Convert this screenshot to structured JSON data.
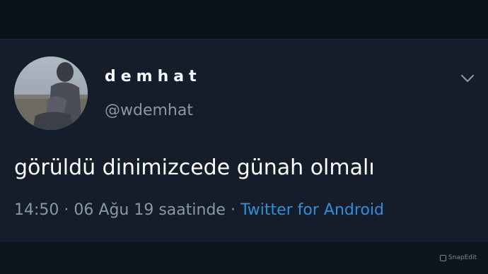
{
  "user": {
    "display_name": "demhat",
    "handle": "@wdemhat"
  },
  "tweet": {
    "text": "görüldü dinimizcede günah olmalı",
    "time": "14:50",
    "separator": "·",
    "date": "06 Ağu 19 saatinde",
    "source": "Twitter for Android"
  },
  "icons": {
    "menu": "chevron-down-icon",
    "watermark": "snapedit-logo-icon"
  },
  "watermark": {
    "text": "SnapEdit"
  },
  "colors": {
    "background": "#141d29",
    "name": "#f5f7fa",
    "secondary_text": "#8899a6",
    "link": "#2f8fd8"
  }
}
